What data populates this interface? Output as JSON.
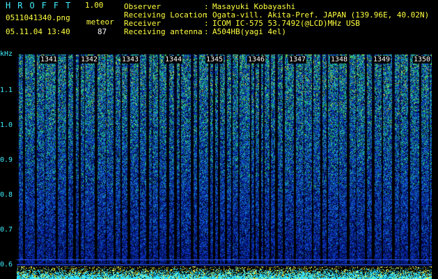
{
  "header": {
    "app_title": "HROFFT",
    "version": "1.00",
    "filename": "0511041340.png",
    "mode": "meteor",
    "datetime": "05.11.04 13:40",
    "count": "87"
  },
  "info": [
    {
      "label": "Observer",
      "value": "Masayuki Kobayashi"
    },
    {
      "label": "Receiving Location",
      "value": "Ogata-vill. Akita-Pref. JAPAN (139.96E, 40.02N)"
    },
    {
      "label": "Receiver",
      "value": "ICOM IC-575 53.7492(@LCD)MHz USB"
    },
    {
      "label": "Receiving antenna",
      "value": "A504HB(yagi 4el)"
    }
  ],
  "axis": {
    "unit": "kHz",
    "ticks": [
      "1.1",
      "1.0",
      "0.9",
      "0.8",
      "0.7",
      "0.6"
    ]
  },
  "minutes": [
    "1341",
    "1342",
    "1343",
    "1344",
    "1345",
    "1346",
    "1347",
    "1348",
    "1349",
    "1350"
  ],
  "colors": {
    "text_cyan": "#3ff0ff",
    "text_yellow": "#ffff40",
    "background": "#000000"
  }
}
